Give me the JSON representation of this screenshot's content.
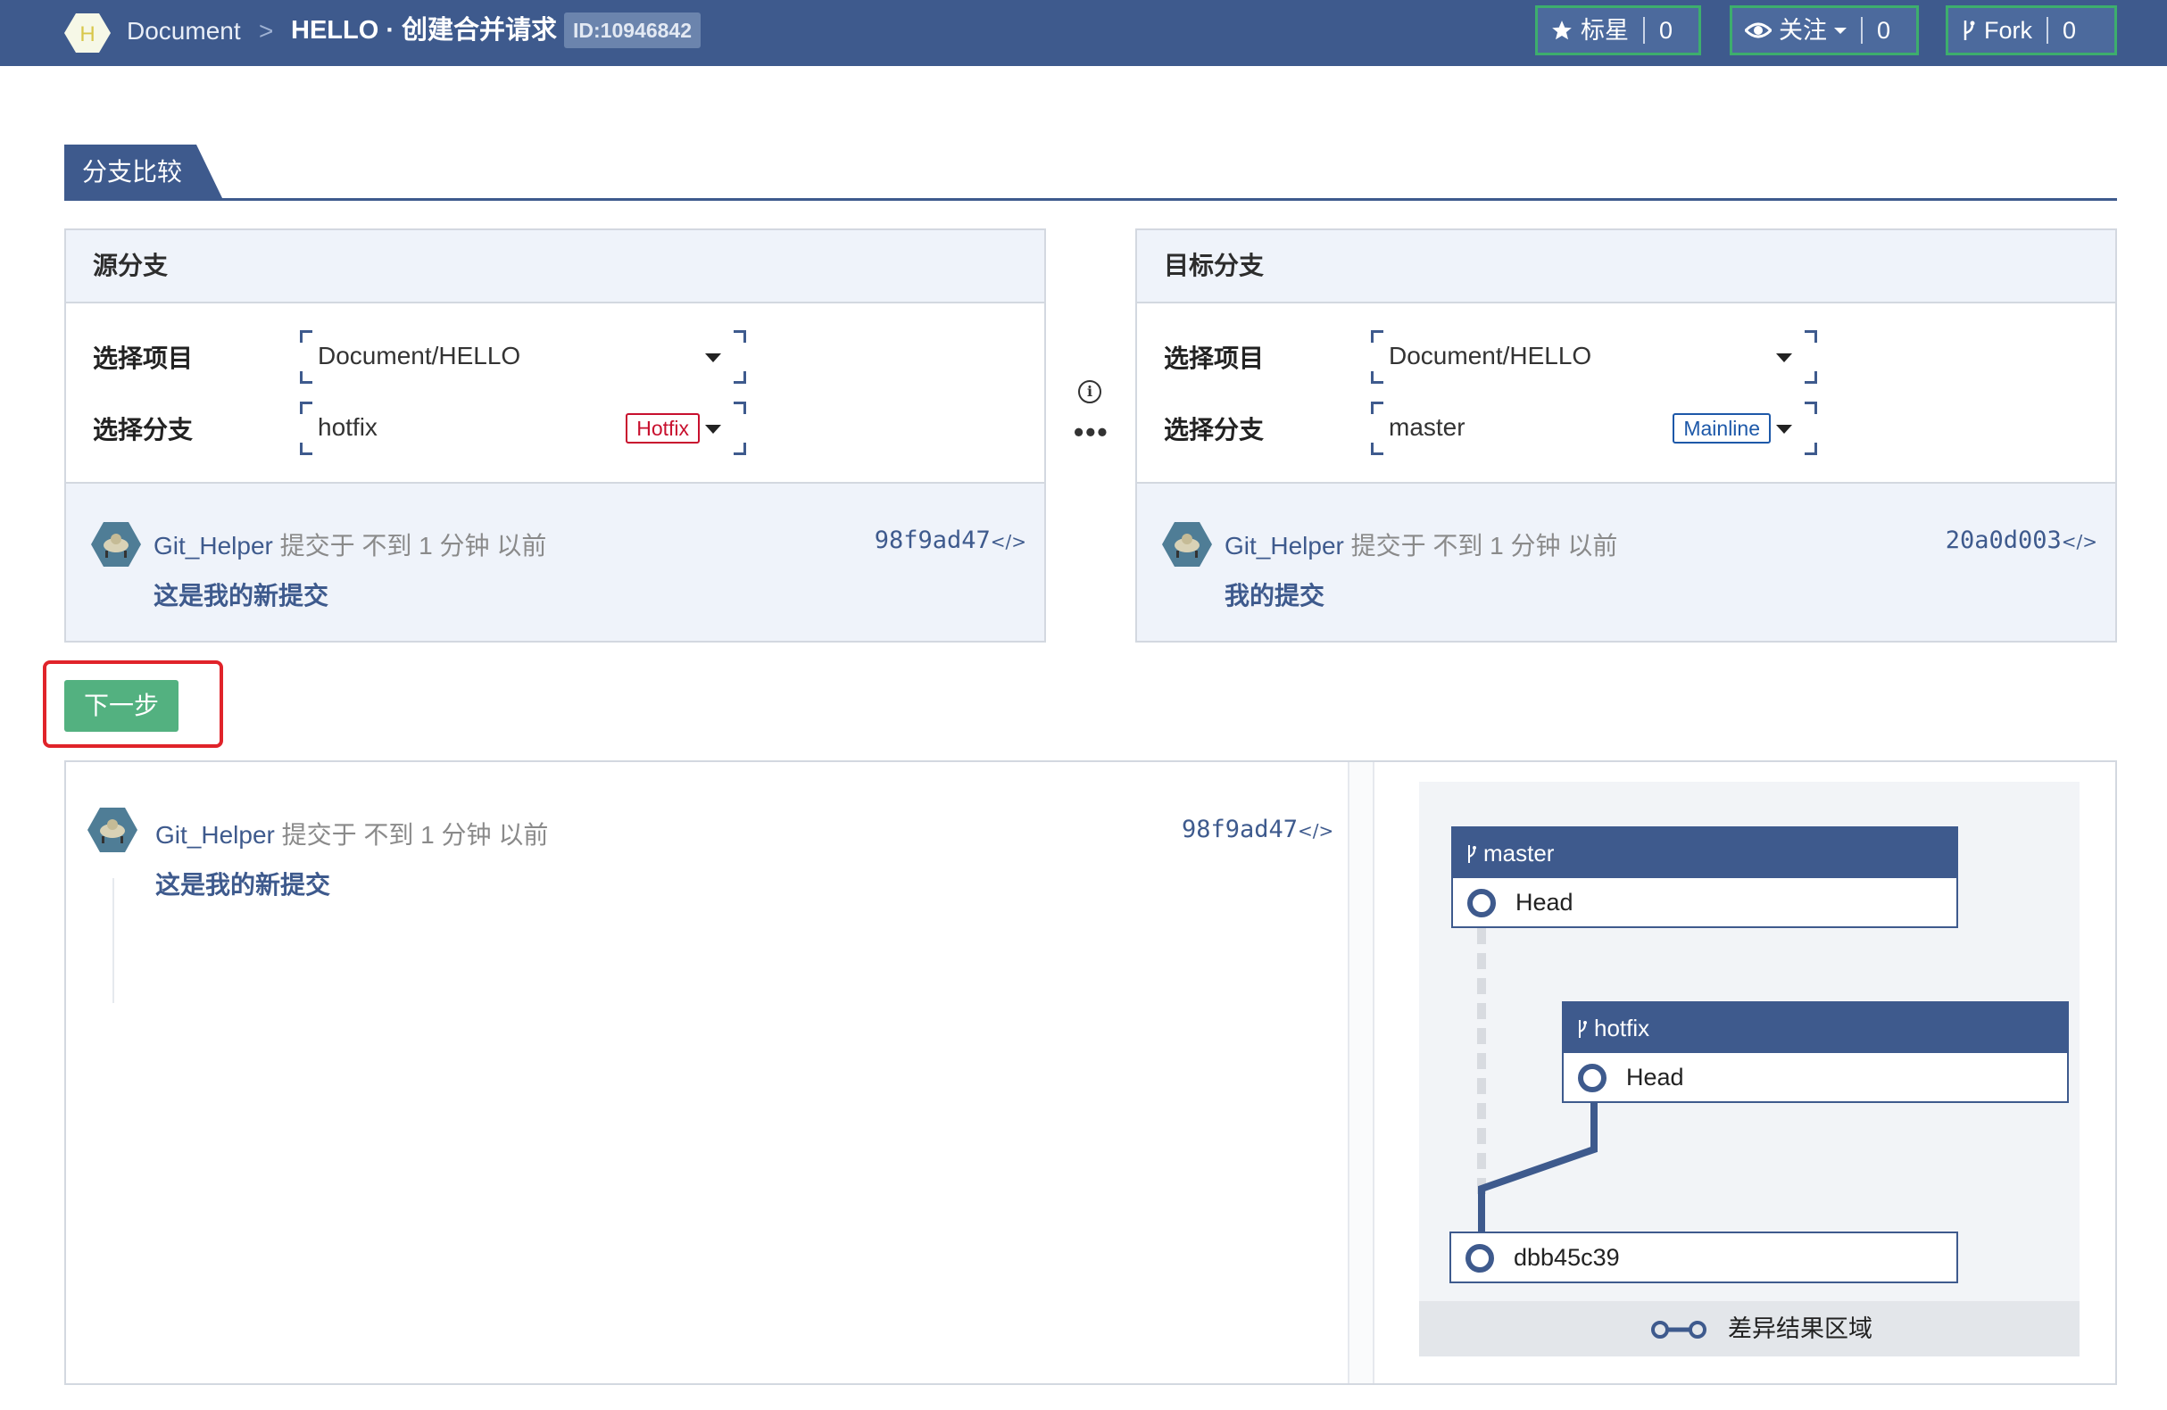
{
  "header": {
    "logo_letter": "H",
    "breadcrumb_org": "Document",
    "breadcrumb_sep": ">",
    "title": "HELLO · 创建合并请求",
    "id_badge": "ID:10946842",
    "star": {
      "label": "标星",
      "count": "0"
    },
    "watch": {
      "label": "关注",
      "count": "0"
    },
    "fork": {
      "label": "Fork",
      "count": "0"
    }
  },
  "section_tab": "分支比较",
  "source": {
    "title": "源分支",
    "project_label": "选择项目",
    "project_value": "Document/HELLO",
    "branch_label": "选择分支",
    "branch_value": "hotfix",
    "branch_badge": "Hotfix",
    "commit": {
      "author": "Git_Helper",
      "meta": "提交于 不到 1 分钟 以前",
      "sha": "98f9ad47",
      "code_icon": "</>",
      "message": "这是我的新提交"
    }
  },
  "target": {
    "title": "目标分支",
    "project_label": "选择项目",
    "project_value": "Document/HELLO",
    "branch_label": "选择分支",
    "branch_value": "master",
    "branch_badge": "Mainline",
    "commit": {
      "author": "Git_Helper",
      "meta": "提交于 不到 1 分钟 以前",
      "sha": "20a0d003",
      "code_icon": "</>",
      "message": "我的提交"
    }
  },
  "middle": {
    "info": "i",
    "dots": "•••"
  },
  "next_button": "下一步",
  "result": {
    "commit": {
      "author": "Git_Helper",
      "meta": "提交于 不到 1 分钟 以前",
      "sha": "98f9ad47",
      "code_icon": "</>",
      "message": "这是我的新提交"
    },
    "graph": {
      "master": {
        "branch": "master",
        "row": "Head"
      },
      "hotfix": {
        "branch": "hotfix",
        "row": "Head"
      },
      "base": {
        "row": "dbb45c39"
      },
      "legend": "差异结果区域"
    }
  },
  "colors": {
    "primary": "#3e5a8d",
    "success": "#53b180",
    "danger": "#e0232a",
    "panel_bg": "#eff3fa"
  }
}
